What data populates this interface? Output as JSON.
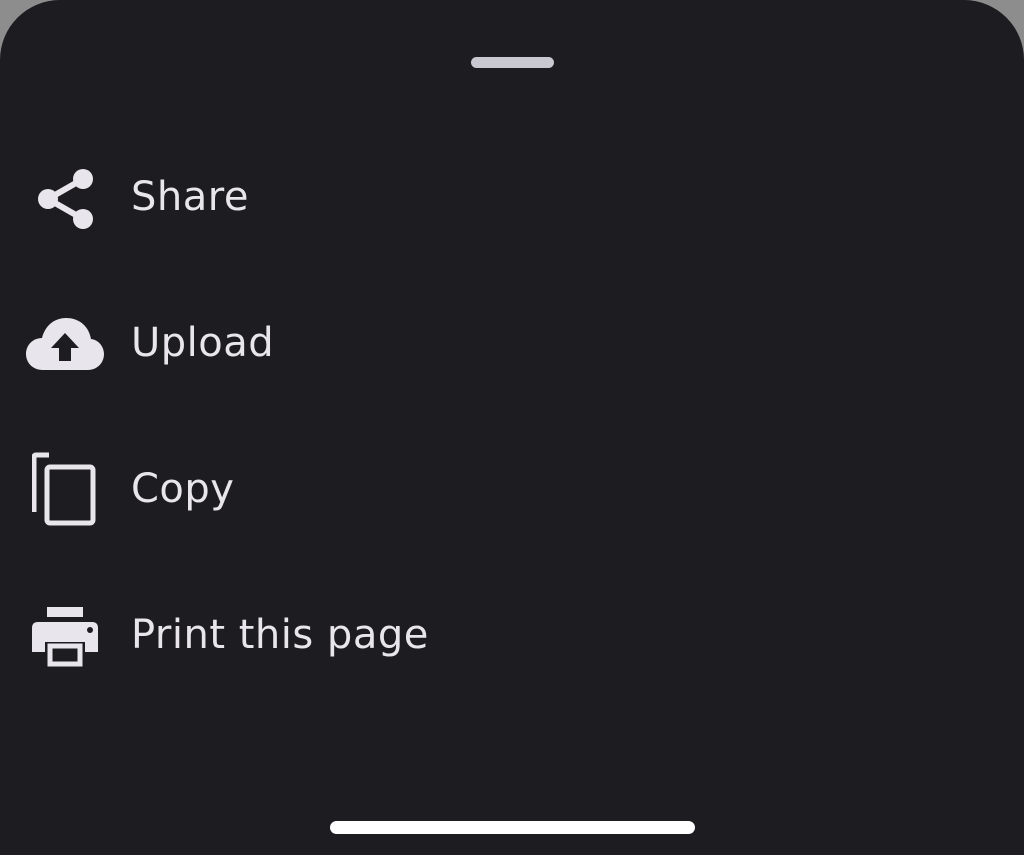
{
  "sheet": {
    "background": "#1d1c21",
    "text_color": "#e8e6ec"
  },
  "menu": {
    "items": [
      {
        "label": "Share",
        "icon": "share-icon"
      },
      {
        "label": "Upload",
        "icon": "cloud-upload-icon"
      },
      {
        "label": "Copy",
        "icon": "copy-icon"
      },
      {
        "label": "Print this page",
        "icon": "printer-icon"
      }
    ]
  }
}
